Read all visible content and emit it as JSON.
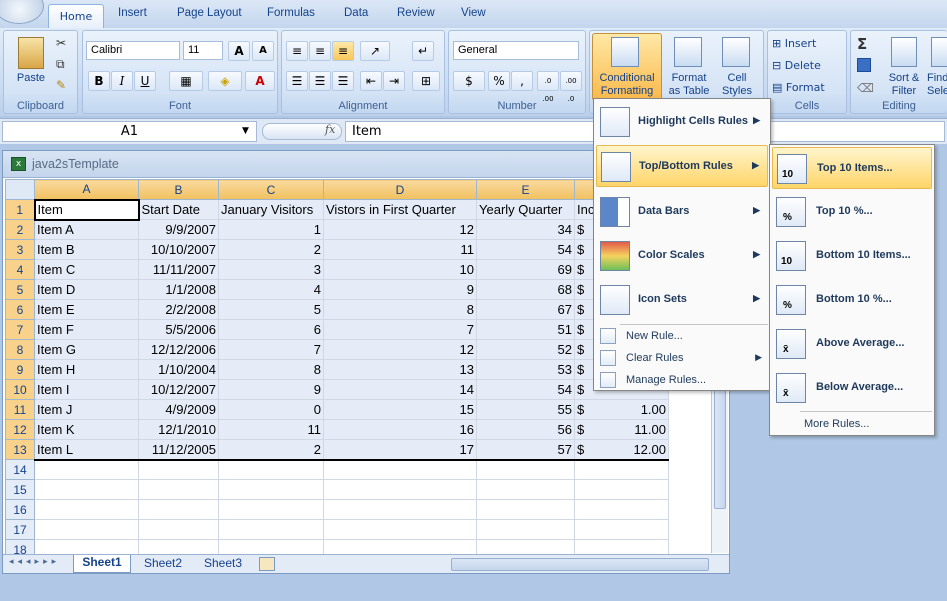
{
  "ribbon_tabs": [
    "Home",
    "Insert",
    "Page Layout",
    "Formulas",
    "Data",
    "Review",
    "View"
  ],
  "clipboard": {
    "paste_label": "Paste",
    "group_label": "Clipboard"
  },
  "font": {
    "name": "Calibri",
    "size": "11",
    "group_label": "Font",
    "bold": "B",
    "italic": "I",
    "underline": "U",
    "grow": "A",
    "shrink": "A",
    "color_a": "A"
  },
  "alignment": {
    "group_label": "Alignment"
  },
  "number": {
    "format": "General",
    "group_label": "Number",
    "currency": "$",
    "percent": "%",
    "comma": ",",
    "inc_dec": ".0 .00",
    "dec_dec": ".00 .0"
  },
  "styles": {
    "cond_fmt_line1": "Conditional",
    "cond_fmt_line2": "Formatting",
    "fmt_table_line1": "Format",
    "fmt_table_line2": "as Table",
    "cell_styles_line1": "Cell",
    "cell_styles_line2": "Styles"
  },
  "cells": {
    "insert": "Insert",
    "delete": "Delete",
    "format": "Format",
    "group_label": "Cells"
  },
  "editing": {
    "sigma": "Σ",
    "sort_line1": "Sort &",
    "sort_line2": "Filter",
    "find_line1": "Find",
    "find_line2": "Sele",
    "group_label": "Editing"
  },
  "formula_bar": {
    "name_box": "A1",
    "fx": "fx",
    "content": "Item"
  },
  "workbook": {
    "title": "java2sTemplate"
  },
  "grid": {
    "columns": [
      "A",
      "B",
      "C",
      "D",
      "E",
      "F"
    ],
    "column_f_partial": "Inc",
    "header": [
      "Item",
      "Start Date",
      "January Visitors",
      "Vistors in First Quarter",
      "Yearly Quarter",
      "Inc"
    ],
    "rows": [
      [
        "Item A",
        "9/9/2007",
        "1",
        "12",
        "34",
        "$"
      ],
      [
        "Item B",
        "10/10/2007",
        "2",
        "11",
        "54",
        "$"
      ],
      [
        "Item C",
        "11/11/2007",
        "3",
        "10",
        "69",
        "$"
      ],
      [
        "Item D",
        "1/1/2008",
        "4",
        "9",
        "68",
        "$"
      ],
      [
        "Item E",
        "2/2/2008",
        "5",
        "8",
        "67",
        "$"
      ],
      [
        "Item F",
        "5/5/2006",
        "6",
        "7",
        "51",
        "$"
      ],
      [
        "Item G",
        "12/12/2006",
        "7",
        "12",
        "52",
        "$"
      ],
      [
        "Item H",
        "1/10/2004",
        "8",
        "13",
        "53",
        "$"
      ],
      [
        "Item I",
        "10/12/2007",
        "9",
        "14",
        "54",
        "$"
      ],
      [
        "Item J",
        "4/9/2009",
        "0",
        "15",
        "55",
        "$"
      ],
      [
        "Item K",
        "12/1/2010",
        "11",
        "16",
        "56",
        "$"
      ],
      [
        "Item L",
        "11/12/2005",
        "2",
        "17",
        "57",
        "$"
      ]
    ],
    "f_values_visible": [
      "",
      "",
      "",
      "",
      "",
      "",
      "",
      "",
      "",
      "1.00",
      "11.00",
      "12.00"
    ],
    "row_numbers": [
      "1",
      "2",
      "3",
      "4",
      "5",
      "6",
      "7",
      "8",
      "9",
      "10",
      "11",
      "12",
      "13",
      "14",
      "15",
      "16",
      "17",
      "18"
    ]
  },
  "sheet_tabs": [
    "Sheet1",
    "Sheet2",
    "Sheet3"
  ],
  "cf_menu": {
    "items": [
      "Highlight Cells Rules",
      "Top/Bottom Rules",
      "Data Bars",
      "Color Scales",
      "Icon Sets"
    ],
    "small_items": [
      "New Rule...",
      "Clear Rules",
      "Manage Rules..."
    ],
    "highlighted": "Top/Bottom Rules"
  },
  "topbottom_menu": {
    "items": [
      "Top 10 Items...",
      "Top 10 %...",
      "Bottom 10 Items...",
      "Bottom 10 %...",
      "Above Average...",
      "Below Average..."
    ],
    "icon_text": [
      "10",
      "%",
      "10",
      "%",
      "x̄",
      "x̄"
    ],
    "more": "More Rules..."
  },
  "colors": {
    "accent_tab_border": "#8db2e3",
    "highlight": "#ffd569",
    "header_fill": "#f1c15f",
    "selection": "#e6ecf7"
  }
}
